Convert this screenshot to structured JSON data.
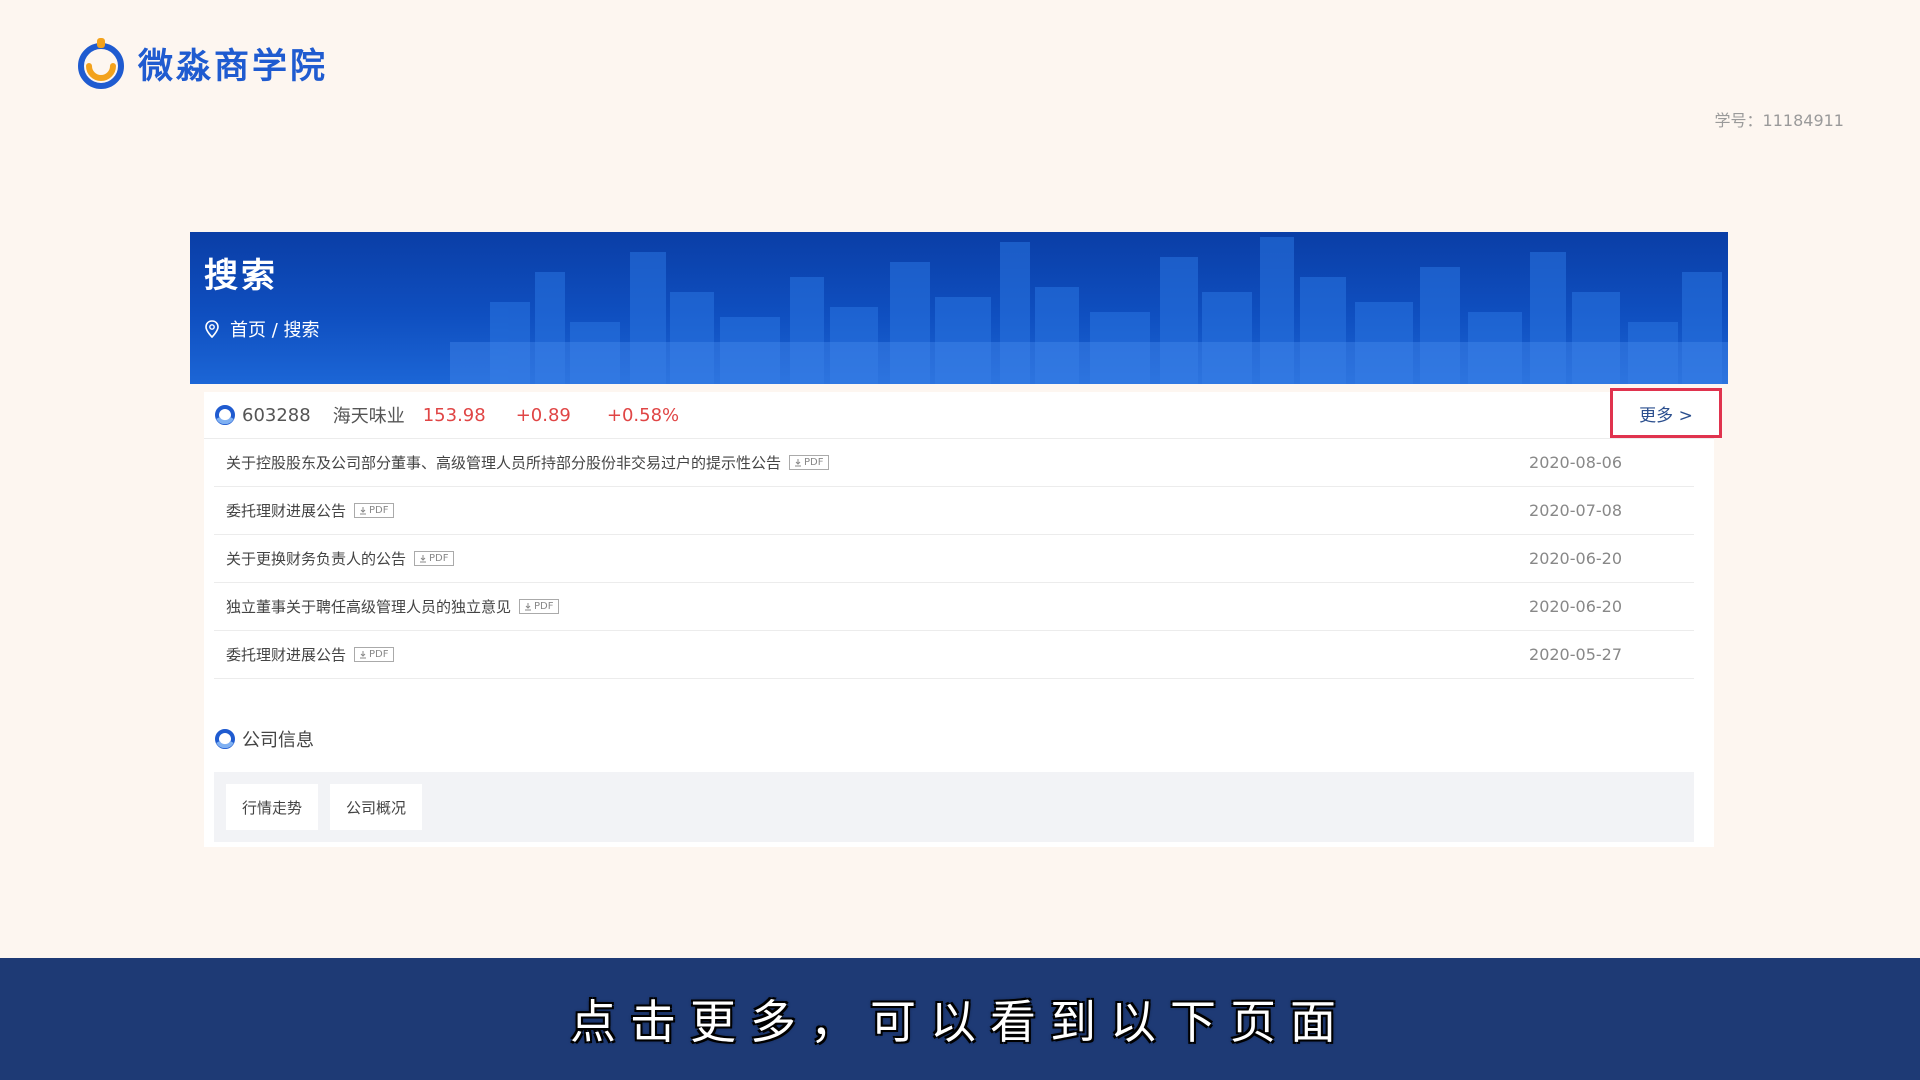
{
  "header": {
    "logo_text": "微淼商学院",
    "student_id": "学号：11184911"
  },
  "banner": {
    "title": "搜索",
    "breadcrumb": "首页 / 搜索"
  },
  "quote": {
    "code": "603288",
    "name": "海天味业",
    "price": "153.98",
    "change": "+0.89",
    "change_pct": "+0.58%",
    "more_label": "更多 >"
  },
  "notices": [
    {
      "title": "关于控股股东及公司部分董事、高级管理人员所持部分股份非交易过户的提示性公告",
      "tag": "PDF",
      "date": "2020-08-06"
    },
    {
      "title": "委托理财进展公告",
      "tag": "PDF",
      "date": "2020-07-08"
    },
    {
      "title": "关于更换财务负责人的公告",
      "tag": "PDF",
      "date": "2020-06-20"
    },
    {
      "title": "独立董事关于聘任高级管理人员的独立意见",
      "tag": "PDF",
      "date": "2020-06-20"
    },
    {
      "title": "委托理财进展公告",
      "tag": "PDF",
      "date": "2020-05-27"
    }
  ],
  "company": {
    "label": "公司信息",
    "tabs": [
      "行情走势",
      "公司概况"
    ]
  },
  "subtitle": "点击更多，可以看到以下页面",
  "colors": {
    "brand_blue": "#1f5bd0",
    "banner_blue": "#0f4fc0",
    "price_red": "#e04545",
    "highlight_red": "#e0334e",
    "subtitle_bg": "#1e3a75"
  },
  "icons": [
    "logo-icon",
    "location-pin-icon",
    "ring-icon",
    "pdf-icon"
  ]
}
